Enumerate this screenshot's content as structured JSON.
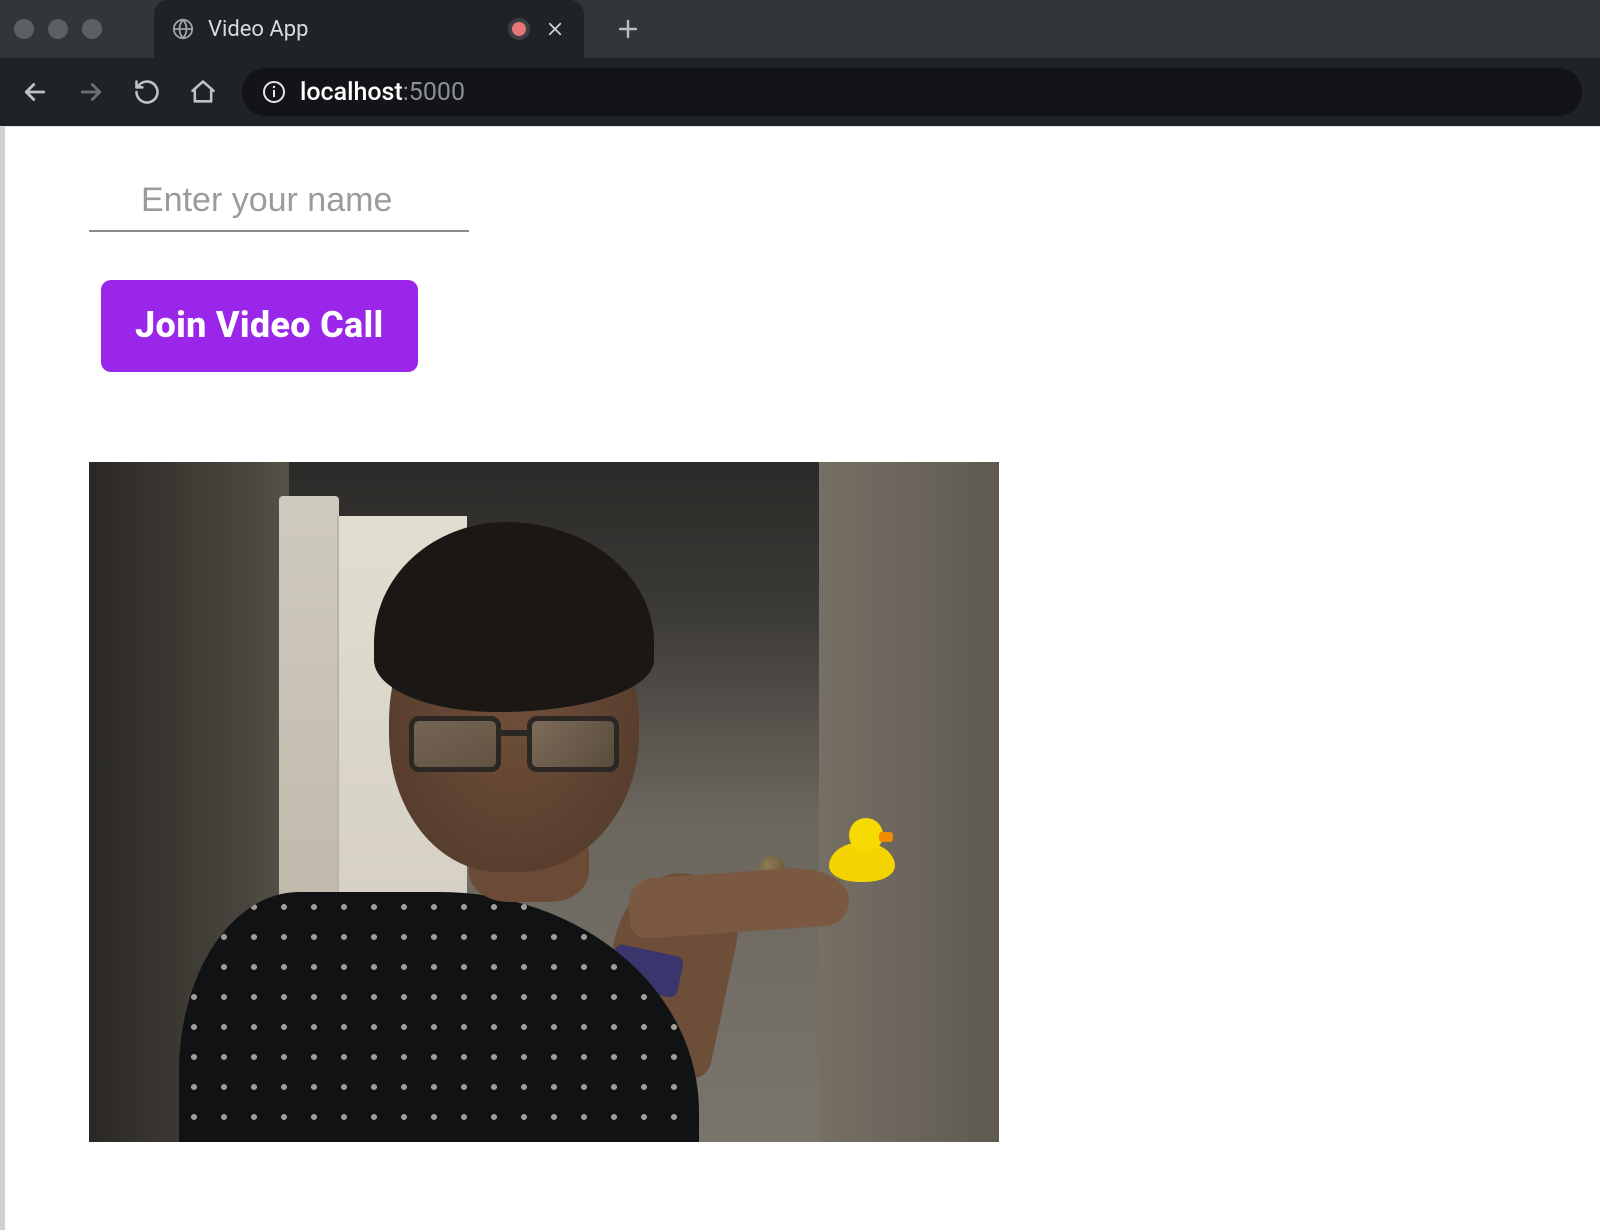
{
  "browser": {
    "tab": {
      "title": "Video App",
      "favicon": "globe-icon",
      "recording": true
    },
    "url": {
      "host": "localhost",
      "port": ":5000"
    }
  },
  "app": {
    "name_input": {
      "placeholder": "Enter your name",
      "value": ""
    },
    "join_button_label": "Join Video Call",
    "accent_color": "#9a26ea",
    "video_preview_alt": "Local webcam preview: person holding a small yellow rubber duck"
  }
}
